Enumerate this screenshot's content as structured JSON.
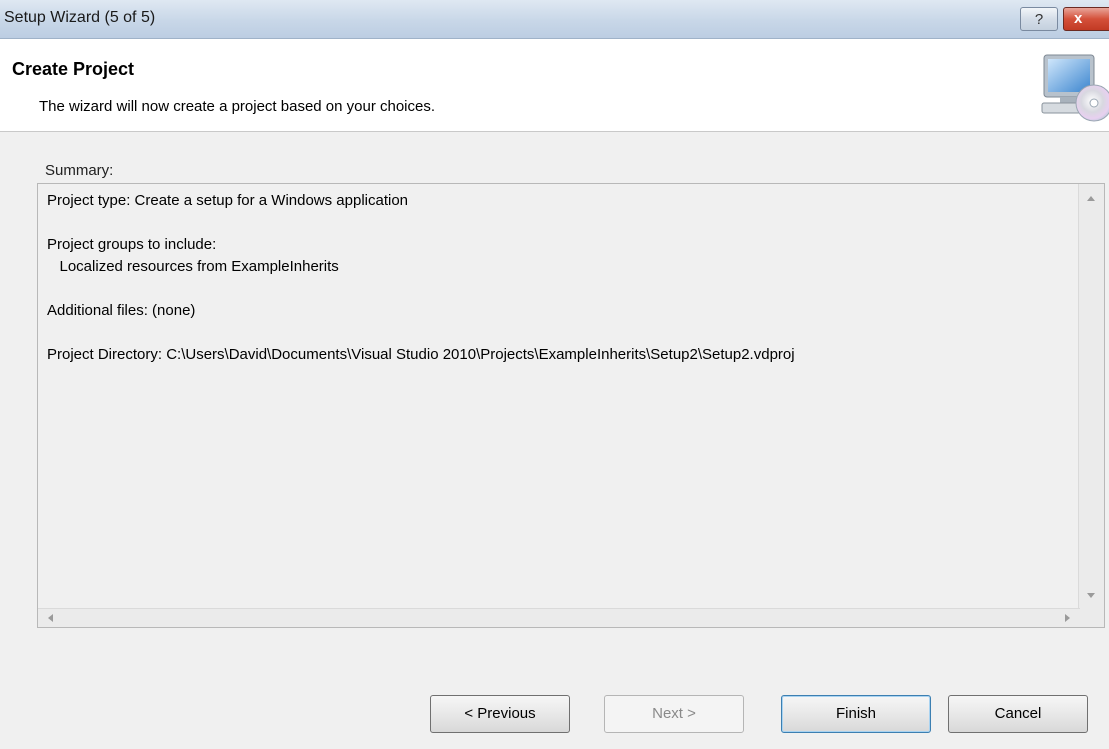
{
  "window": {
    "title": "Setup Wizard (5 of 5)",
    "help_glyph": "?",
    "close_glyph": "x"
  },
  "header": {
    "heading": "Create Project",
    "subtitle": "The wizard will now create a project based on your choices.",
    "icon": "computer-setup-cd-icon"
  },
  "summary": {
    "label": "Summary:",
    "text": "Project type: Create a setup for a Windows application\n\nProject groups to include:\n   Localized resources from ExampleInherits\n\nAdditional files: (none)\n\nProject Directory: C:\\Users\\David\\Documents\\Visual Studio 2010\\Projects\\ExampleInherits\\Setup2\\Setup2.vdproj"
  },
  "buttons": {
    "previous": "< Previous",
    "next": "Next >",
    "finish": "Finish",
    "cancel": "Cancel"
  }
}
